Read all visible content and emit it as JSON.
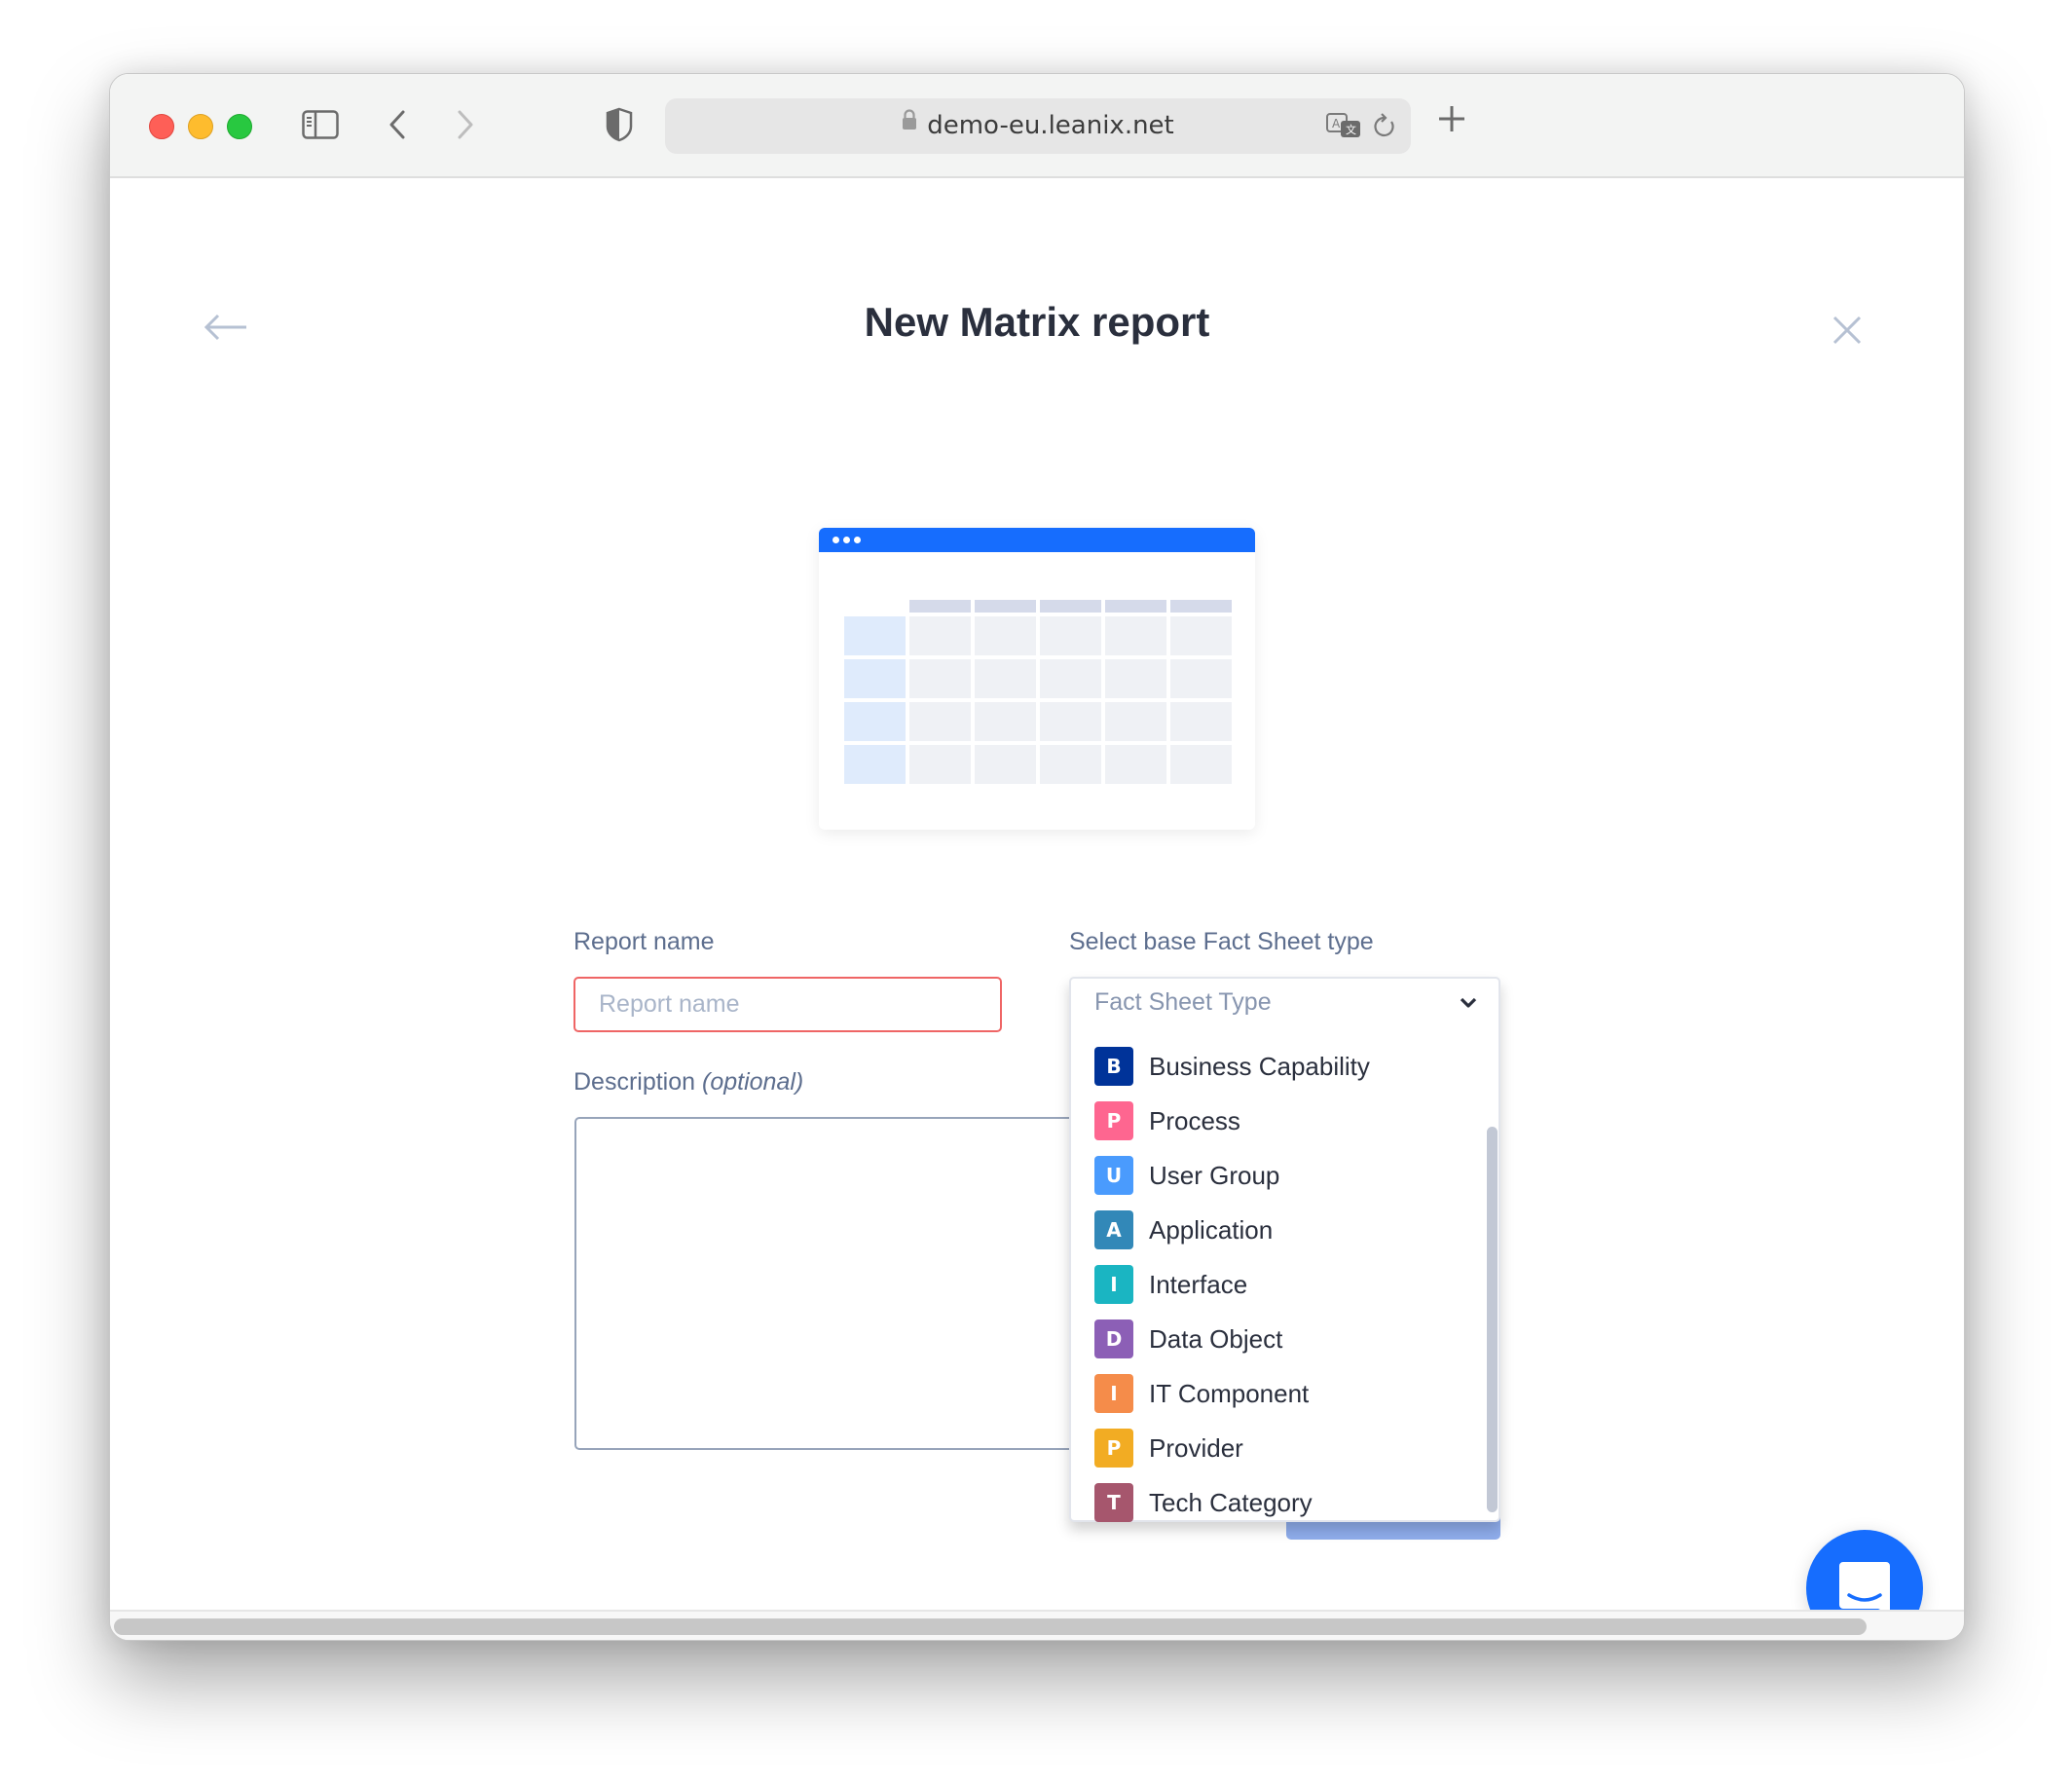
{
  "browser": {
    "url": "demo-eu.leanix.net",
    "icons": {
      "close": "traffic-close",
      "minimize": "traffic-minimize",
      "zoom": "traffic-zoom",
      "sidebar": "sidebar-icon",
      "back": "chevron-left-icon",
      "forward": "chevron-right-icon",
      "privacy": "shield-icon",
      "lock": "lock-icon",
      "translate": "translate-icon",
      "reload": "reload-icon",
      "new_tab": "plus-icon"
    }
  },
  "page": {
    "title": "New Matrix report",
    "back_icon": "arrow-left-icon",
    "close_icon": "close-icon"
  },
  "form": {
    "report_name": {
      "label": "Report name",
      "value": "",
      "placeholder": "Report name",
      "error_color": "#ef6565"
    },
    "description": {
      "label": "Description",
      "label_suffix": "(optional)",
      "value": ""
    },
    "fact_sheet_type": {
      "label": "Select base Fact Sheet type",
      "placeholder": "Fact Sheet Type",
      "options": [
        {
          "letter": "B",
          "label": "Business Capability",
          "color": "#003399"
        },
        {
          "letter": "P",
          "label": "Process",
          "color": "#fe6690"
        },
        {
          "letter": "U",
          "label": "User Group",
          "color": "#4a9bfd"
        },
        {
          "letter": "A",
          "label": "Application",
          "color": "#3288b8"
        },
        {
          "letter": "I",
          "label": "Interface",
          "color": "#1ab5c2"
        },
        {
          "letter": "D",
          "label": "Data Object",
          "color": "#8c5fb6"
        },
        {
          "letter": "I",
          "label": "IT Component",
          "color": "#f58c4a"
        },
        {
          "letter": "P",
          "label": "Provider",
          "color": "#f2ac23"
        },
        {
          "letter": "T",
          "label": "Tech Category",
          "color": "#a6566d"
        }
      ]
    }
  },
  "chat": {
    "icon": "chat-icon",
    "color": "#166dfe"
  },
  "colors": {
    "accent": "#166dfe",
    "text": "#2a2f3d",
    "label": "#5d6e8e"
  }
}
